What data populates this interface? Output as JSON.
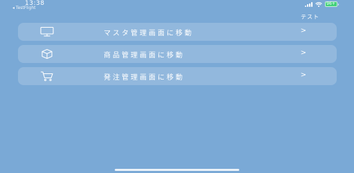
{
  "status_bar": {
    "time": "13:38",
    "back_app": "◂ TestFlight",
    "battery": "96+"
  },
  "nav": {
    "right_label": "テスト"
  },
  "menu": {
    "items": [
      {
        "icon": "monitor-icon",
        "label": "マスタ管理画面に移動",
        "chevron": ">"
      },
      {
        "icon": "box-icon",
        "label": "商品管理画面に移動",
        "chevron": ">"
      },
      {
        "icon": "cart-icon",
        "label": "発注管理画面に移動",
        "chevron": ">"
      }
    ]
  },
  "colors": {
    "background": "#7aa9d6",
    "row_fill": "rgba(255,255,255,0.18)",
    "battery": "#43d17a"
  }
}
